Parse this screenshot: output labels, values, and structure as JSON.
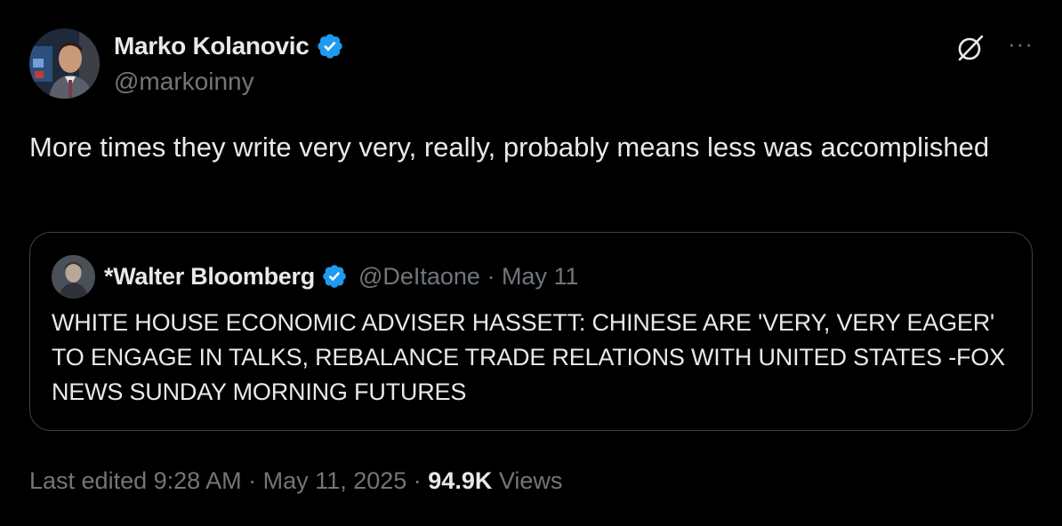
{
  "author": {
    "display_name": "Marko Kolanovic",
    "handle": "@markoinny",
    "verified_icon": "verified-badge-icon",
    "avatar_icon": "avatar-photo"
  },
  "actions": {
    "grok_icon": "grok-icon",
    "more_label": "···"
  },
  "tweet": {
    "text": "More times they write very very, really, probably means less was accomplished"
  },
  "quote": {
    "display_name": "*Walter Bloomberg",
    "handle": "@DeItaone",
    "separator": " · ",
    "date": "May 11",
    "text": "WHITE HOUSE ECONOMIC ADVISER HASSETT: CHINESE ARE 'VERY, VERY EAGER' TO ENGAGE IN TALKS, REBALANCE TRADE RELATIONS WITH UNITED STATES -FOX NEWS SUNDAY MORNING FUTURES"
  },
  "footer": {
    "edited_label": "Last edited 9:28 AM",
    "sep1": " · ",
    "date": "May 11, 2025",
    "sep2": " · ",
    "views_count": "94.9K",
    "views_label": " Views"
  },
  "colors": {
    "background": "#000000",
    "text_primary": "#e7e9ea",
    "text_secondary": "#71767b",
    "verified_blue": "#1d9bf0",
    "border": "#3e4144"
  }
}
